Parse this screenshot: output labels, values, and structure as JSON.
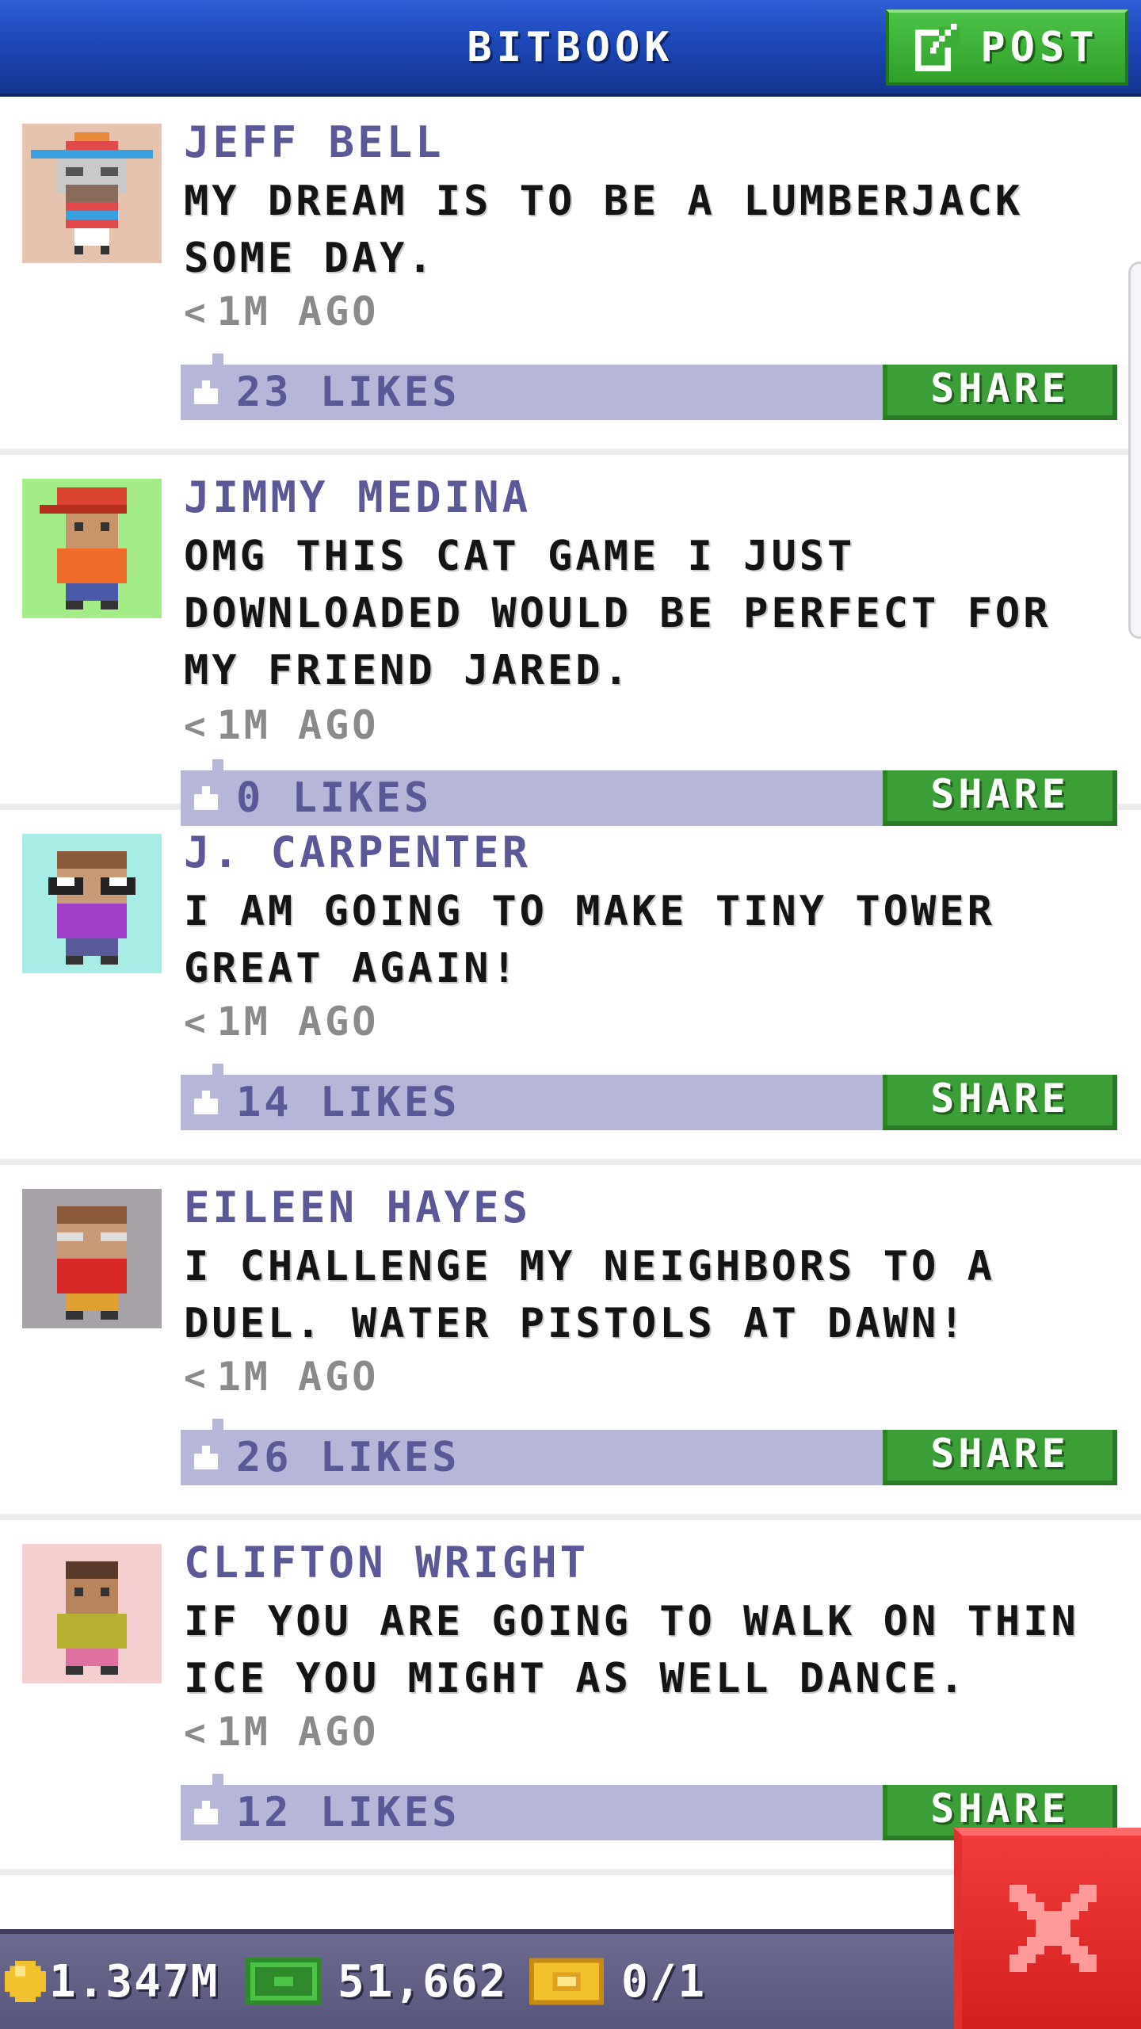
{
  "header": {
    "title": "BITBOOK",
    "post_label": "POST"
  },
  "posts": [
    {
      "author": "JEFF BELL",
      "message": "MY DREAM IS TO BE A LUMBERJACK SOME DAY.",
      "time": "1M AGO",
      "time_prefix": "<",
      "likes": "23 LIKES",
      "share_label": "SHARE",
      "avatar_bg": "#e6c3ae"
    },
    {
      "author": "JIMMY MEDINA",
      "message": "OMG THIS CAT GAME I JUST DOWNLOADED WOULD BE PERFECT FOR MY FRIEND JARED.",
      "time": "1M AGO",
      "time_prefix": "<",
      "likes": "0 LIKES",
      "share_label": "SHARE",
      "avatar_bg": "#a4ec88"
    },
    {
      "author": "J. CARPENTER",
      "message": "I AM GOING TO MAKE TINY TOWER GREAT AGAIN!",
      "time": "1M AGO",
      "time_prefix": "<",
      "likes": "14 LIKES",
      "share_label": "SHARE",
      "avatar_bg": "#a8ece6"
    },
    {
      "author": "EILEEN HAYES",
      "message": "I CHALLENGE MY NEIGHBORS TO A DUEL. WATER PISTOLS AT DAWN!",
      "time": "1M AGO",
      "time_prefix": "<",
      "likes": "26 LIKES",
      "share_label": "SHARE",
      "avatar_bg": "#a7a2a8"
    },
    {
      "author": "CLIFTON WRIGHT",
      "message": "IF YOU ARE GOING TO WALK ON THIN ICE YOU MIGHT AS WELL DANCE.",
      "time": "1M AGO",
      "time_prefix": "<",
      "likes": "12 LIKES",
      "share_label": "SHARE",
      "avatar_bg": "#f5cfcf"
    }
  ],
  "footer": {
    "coins": "1.347M",
    "bux": "51,662",
    "tickets": "0/1"
  },
  "colors": {
    "header_blue": "#1d47b8",
    "post_green": "#3c9e36",
    "author_purple": "#5b5898",
    "likes_bar": "#b5b6d8",
    "close_red": "#d41f1f"
  },
  "icons": {
    "post": "compose-icon",
    "like": "thumbs-up-icon",
    "coin": "coin-icon",
    "bux": "bux-icon",
    "ticket": "ticket-icon",
    "close": "close-icon"
  }
}
